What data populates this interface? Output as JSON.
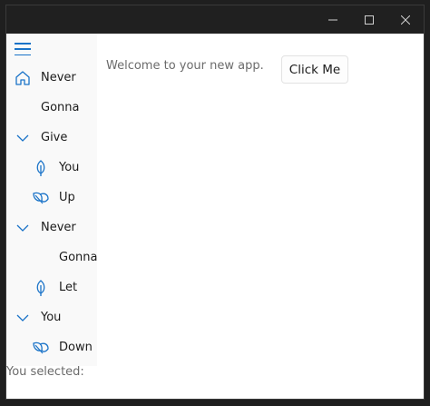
{
  "window": {
    "controls": {
      "minimize": "—",
      "maximize": "☐",
      "close": "✕"
    }
  },
  "nav": {
    "menu_icon": "hamburger-icon",
    "items": [
      {
        "label": "Never",
        "icon": "home-icon"
      },
      {
        "label": "Gonna",
        "icon": ""
      },
      {
        "label": "Give",
        "icon": "chevron-down-icon"
      },
      {
        "label": "You",
        "icon": "leaf-icon"
      },
      {
        "label": "Up",
        "icon": "leaves-icon"
      },
      {
        "label": "Never",
        "icon": "chevron-down-icon"
      },
      {
        "label": "Gonna",
        "icon": ""
      },
      {
        "label": "Let",
        "icon": "leaf-icon"
      },
      {
        "label": "You",
        "icon": "chevron-down-icon"
      },
      {
        "label": "Down",
        "icon": "leaves-icon"
      }
    ]
  },
  "main": {
    "welcome_text": "Welcome to your new app.",
    "button_label": "Click Me",
    "selected_label": "You selected:"
  },
  "colors": {
    "accent": "#1a73c8",
    "titlebar": "#202020",
    "nav_bg": "#f9f9f9"
  }
}
